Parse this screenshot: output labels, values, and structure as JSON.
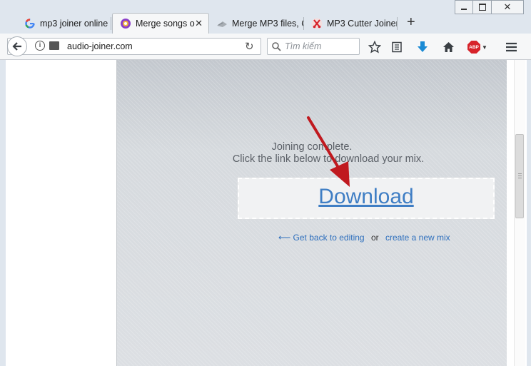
{
  "tabs": [
    {
      "label": "mp3 joiner online",
      "icon": "google-icon"
    },
    {
      "label": "Merge songs o",
      "icon": "audio-joiner-icon",
      "close": "✕"
    },
    {
      "label": "Merge MP3 files, C",
      "icon": "file-icon"
    },
    {
      "label": "MP3 Cutter Joiner",
      "icon": "scissors-icon"
    }
  ],
  "new_tab": "+",
  "navbar": {
    "url": "audio-joiner.com",
    "search_placeholder": "Tìm kiếm"
  },
  "toolbar_icons": [
    "bookmark-star-icon",
    "reader-list-icon",
    "download-arrow-icon",
    "home-icon",
    "adblock-icon",
    "menu-icon"
  ],
  "adblock_label": "ABP",
  "content": {
    "line1": "Joining complete.",
    "line2": "Click the link below to download your mix.",
    "download": "Download",
    "back_arrow": "⟵",
    "back_link": "Get back to editing",
    "or": "or",
    "new_link": "create a new mix"
  },
  "colors": {
    "link": "#3f7ec4",
    "arrow": "#c0191f",
    "download_toolbar_icon": "#1a8ad4"
  }
}
